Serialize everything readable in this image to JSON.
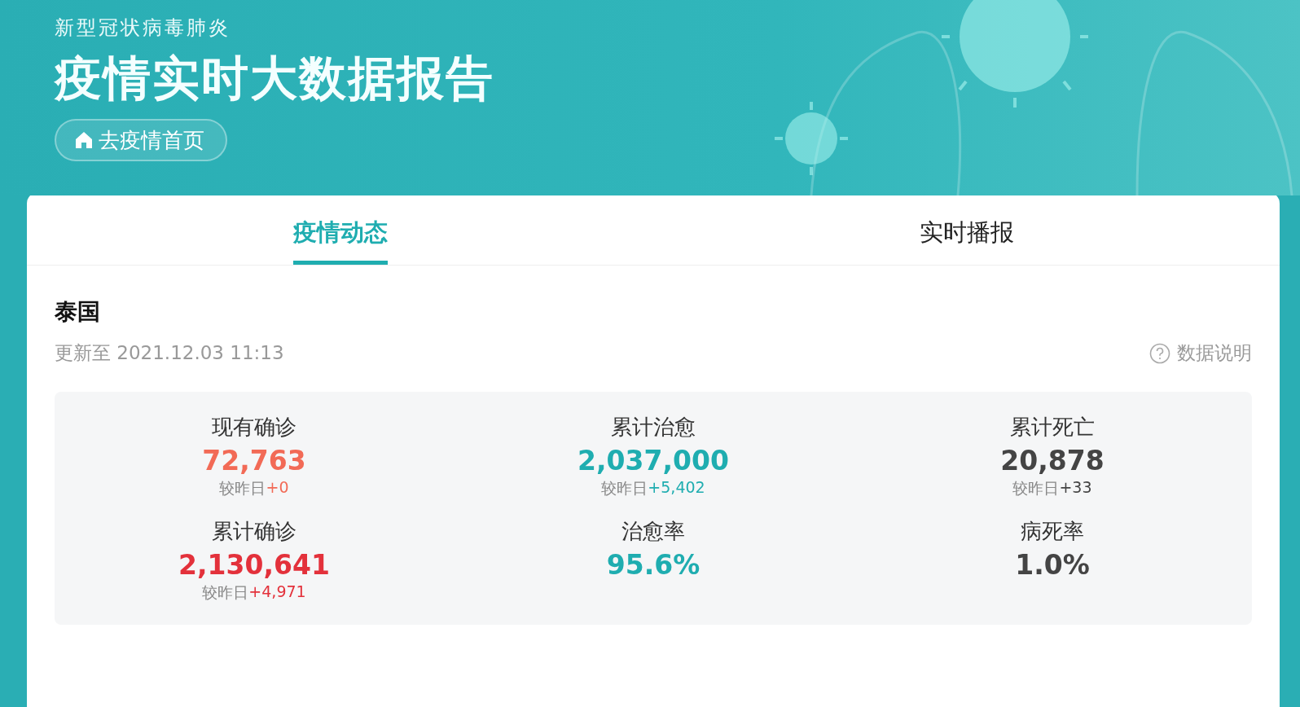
{
  "header": {
    "subtitle": "新型冠状病毒肺炎",
    "title": "疫情实时大数据报告",
    "home_button": "去疫情首页"
  },
  "tabs": [
    {
      "label": "疫情动态",
      "selected": true
    },
    {
      "label": "实时播报",
      "selected": false
    }
  ],
  "region": {
    "name": "泰国",
    "updated": "更新至 2021.12.03 11:13",
    "data_note": "数据说明"
  },
  "stats": [
    {
      "label": "现有确诊",
      "value": "72,763",
      "compare": "较昨日",
      "delta": "+0",
      "color": "#f26a56"
    },
    {
      "label": "累计治愈",
      "value": "2,037,000",
      "compare": "较昨日",
      "delta": "+5,402",
      "color": "#1fadb0"
    },
    {
      "label": "累计死亡",
      "value": "20,878",
      "compare": "较昨日",
      "delta": "+33",
      "color": "#444444"
    },
    {
      "label": "累计确诊",
      "value": "2,130,641",
      "compare": "较昨日",
      "delta": "+4,971",
      "color": "#e3313b"
    },
    {
      "label": "治愈率",
      "value": "95.6%",
      "color": "#1fadb0"
    },
    {
      "label": "病死率",
      "value": "1.0%",
      "color": "#444444"
    }
  ]
}
